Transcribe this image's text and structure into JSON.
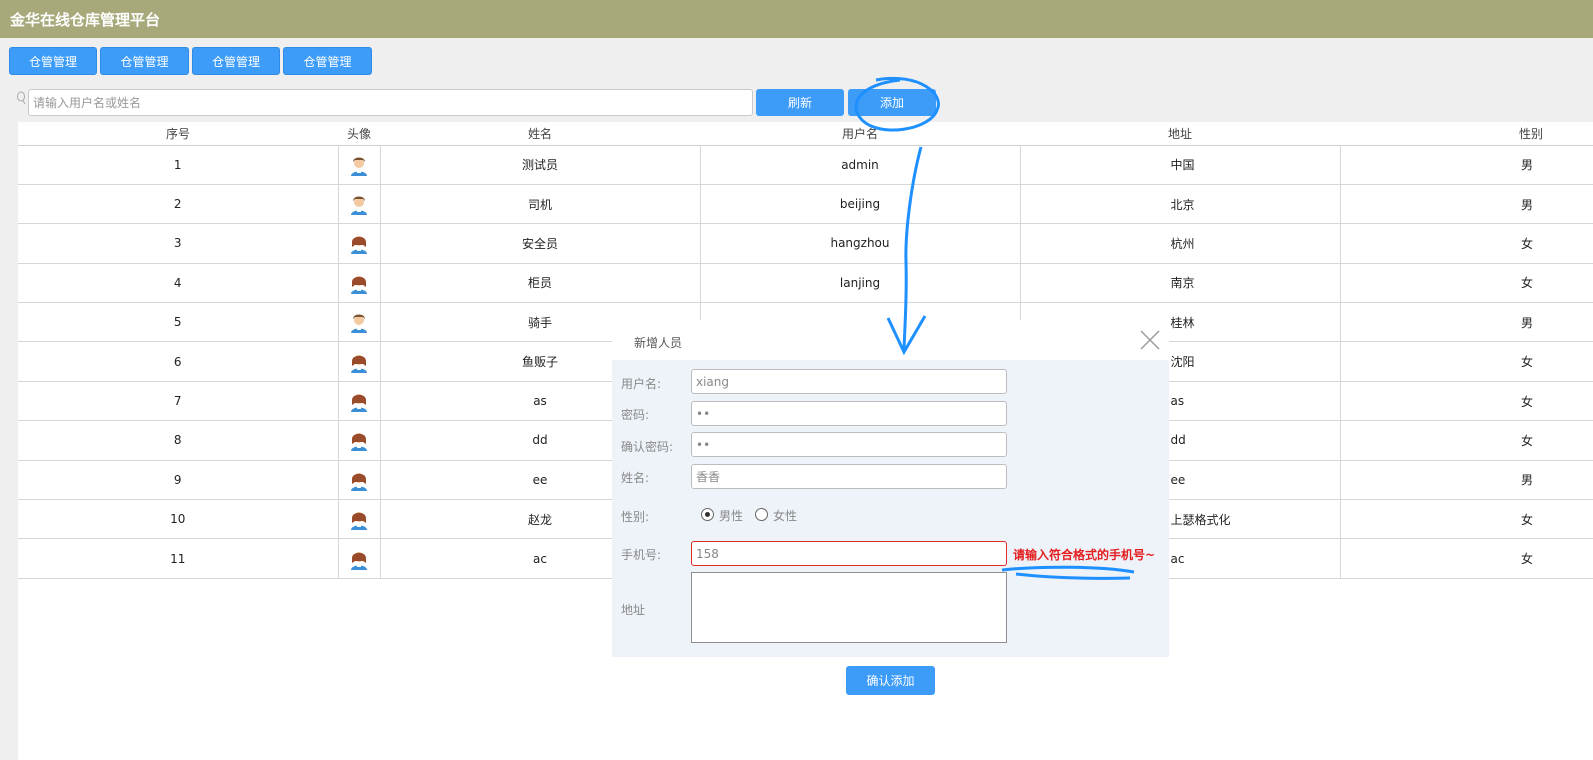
{
  "app": {
    "title": "金华在线仓库管理平台"
  },
  "nav": {
    "items": [
      "仓管管理",
      "仓管管理",
      "仓管管理",
      "仓管管理"
    ]
  },
  "search": {
    "placeholder": "请输入用户名或姓名",
    "refresh_label": "刷新",
    "add_label": "添加"
  },
  "table": {
    "headers": [
      "序号",
      "头像",
      "姓名",
      "用户名",
      "地址",
      "性别"
    ],
    "rows": [
      {
        "no": "1",
        "avatar": "male-avatar-icon",
        "name": "测试员",
        "username": "admin",
        "address": "中国",
        "gender": "男"
      },
      {
        "no": "2",
        "avatar": "male-avatar-icon",
        "name": "司机",
        "username": "beijing",
        "address": "北京",
        "gender": "男"
      },
      {
        "no": "3",
        "avatar": "female-avatar-icon",
        "name": "安全员",
        "username": "hangzhou",
        "address": "杭州",
        "gender": "女"
      },
      {
        "no": "4",
        "avatar": "female-avatar-icon",
        "name": "柜员",
        "username": "lanjing",
        "address": "南京",
        "gender": "女"
      },
      {
        "no": "5",
        "avatar": "male-avatar-icon",
        "name": "骑手",
        "username": "",
        "address": "桂林",
        "gender": "男"
      },
      {
        "no": "6",
        "avatar": "female-avatar-icon",
        "name": "鱼贩子",
        "username": "",
        "address": "沈阳",
        "gender": "女"
      },
      {
        "no": "7",
        "avatar": "female-avatar-icon",
        "name": "as",
        "username": "",
        "address": "as",
        "gender": "女"
      },
      {
        "no": "8",
        "avatar": "female-avatar-icon",
        "name": "dd",
        "username": "",
        "address": "dd",
        "gender": "女"
      },
      {
        "no": "9",
        "avatar": "female-avatar-icon",
        "name": "ee",
        "username": "",
        "address": "ee",
        "gender": "男"
      },
      {
        "no": "10",
        "avatar": "female-avatar-icon",
        "name": "赵龙",
        "username": "",
        "address": "上瑟格式化",
        "gender": "女"
      },
      {
        "no": "11",
        "avatar": "female-avatar-icon",
        "name": "ac",
        "username": "",
        "address": "ac",
        "gender": "女"
      }
    ]
  },
  "dialog": {
    "title": "新增人员",
    "username_label": "用户名:",
    "username_value": "xiang",
    "password_label": "密码:",
    "password_value": "••",
    "confirm_password_label": "确认密码:",
    "confirm_password_value": "••",
    "name_label": "姓名:",
    "name_value": "香香",
    "gender_label": "性别:",
    "gender_options": [
      "男性",
      "女性"
    ],
    "gender_selected": "男性",
    "phone_label": "手机号:",
    "phone_value": "158",
    "phone_error": "请输入符合格式的手机号~",
    "address_label": "地址",
    "confirm_label": "确认添加"
  },
  "colors": {
    "topbar": "#a8a97a",
    "primary": "#3d9cf8",
    "error": "#e41e1e",
    "annotation": "#1e90ff"
  }
}
